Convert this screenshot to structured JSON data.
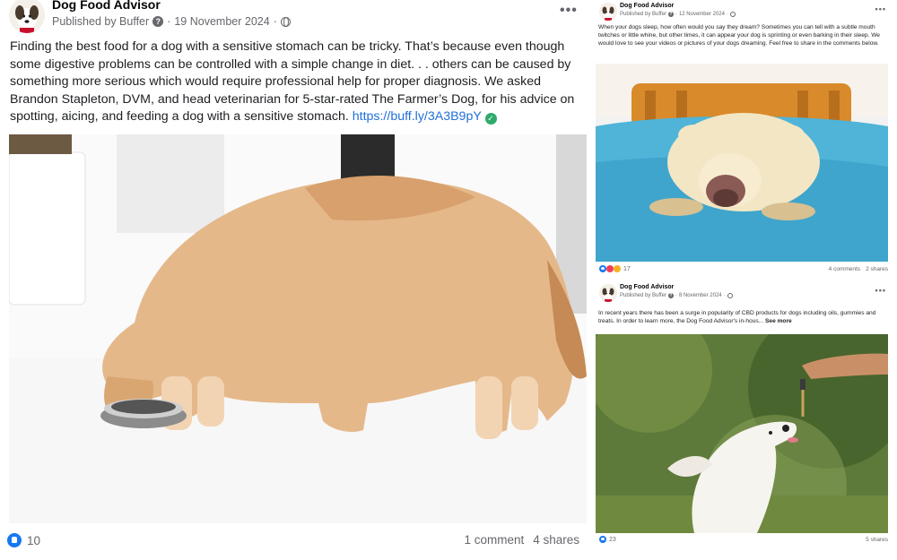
{
  "main_post": {
    "page_name": "Dog Food Advisor",
    "published_by": "Published by Buffer",
    "date": "19 November 2024",
    "separator": "·",
    "text": "Finding the best food for a dog with a sensitive stomach can be tricky. That’s because even though some digestive problems can be controlled with a simple change in diet. . . others can be caused by something more serious which would require professional help for proper diagnosis. We asked Brandon Stapleton, DVM, and head veterinarian for 5-star-rated The Farmer’s Dog, for his advice on spotting, aicing, and feeding a dog with a sensitive stomach.",
    "link": "https://buff.ly/3A3B9pY",
    "reaction_count": "10",
    "comments": "1 comment",
    "shares": "4 shares",
    "icons": [
      "avatar-dog-icon",
      "question-icon",
      "globe-icon",
      "more-options-icon",
      "verified-check-icon",
      "like-icon"
    ]
  },
  "side_posts": [
    {
      "page_name": "Dog Food Advisor",
      "published_by": "Published by Buffer",
      "date": "12 November 2024",
      "text": "When your dogs sleep, how often would you say they dream? Sometimes you can tell with a subtle mouth twitches or little whine, but other times, it can appear your dog is sprinting or even barking in their sleep. We would love to see your videos or pictures of your dogs dreaming. Feel free to share in the comments below.",
      "reaction_count": "17",
      "comments": "4 comments",
      "shares": "2 shares"
    },
    {
      "page_name": "Dog Food Advisor",
      "published_by": "Published by Buffer",
      "date": "8 November 2024",
      "text": "In recent years there has been a surge in popularity of CBD products for dogs including oils, gummies and treats. In order to learn more, the Dog Food Advisor's in-hous...",
      "see_more": "See more",
      "reaction_count": "23",
      "shares": "5 shares"
    }
  ],
  "colors": {
    "link": "#216fdb",
    "like": "#1877f2",
    "muted_text": "#65676b",
    "verified": "#2eaa6a"
  }
}
